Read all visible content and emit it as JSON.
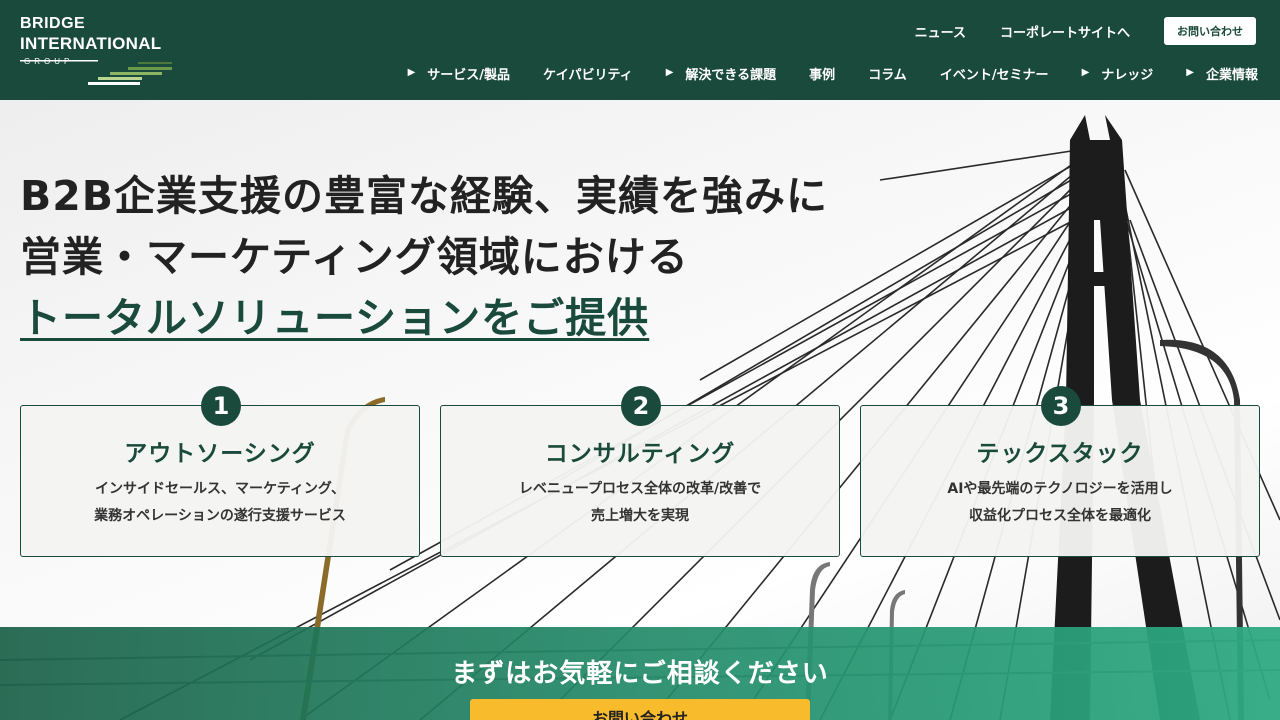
{
  "logo": {
    "line1": "BRIDGE",
    "line2": "INTERNATIONAL",
    "line3": "GROUP",
    "alt": "BRIDGE INTERNATIONAL GROUP"
  },
  "utility_nav": {
    "news": "ニュース",
    "corporate": "コーポレートサイトへ",
    "contact": "お問い合わせ"
  },
  "main_nav": [
    {
      "label": "サービス/製品",
      "has_arrow": true
    },
    {
      "label": "ケイパビリティ",
      "has_arrow": false
    },
    {
      "label": "解決できる課題",
      "has_arrow": true
    },
    {
      "label": "事例",
      "has_arrow": false
    },
    {
      "label": "コラム",
      "has_arrow": false
    },
    {
      "label": "イベント/セミナー",
      "has_arrow": false
    },
    {
      "label": "ナレッジ",
      "has_arrow": true
    },
    {
      "label": "企業情報",
      "has_arrow": true
    }
  ],
  "hero": {
    "line1": "B2B企業支援の豊富な経験、実績を強みに",
    "line2": "営業・マーケティング領域における",
    "line3": "トータルソリューションをご提供"
  },
  "cards": [
    {
      "number": "1",
      "title": "アウトソーシング",
      "desc1": "インサイドセールス、マーケティング、",
      "desc2": "業務オペレーションの遂行支援サービス"
    },
    {
      "number": "2",
      "title": "コンサルティング",
      "desc1": "レベニュープロセス全体の改革/改善で",
      "desc2": "売上増大を実現"
    },
    {
      "number": "3",
      "title": "テックスタック",
      "desc1": "AIや最先端のテクノロジーを活用し",
      "desc2": "収益化プロセス全体を最適化"
    }
  ],
  "cta": {
    "title": "まずはお気軽にご相談ください",
    "button": "お問い合わせ"
  },
  "colors": {
    "brand_green": "#1a4a3b",
    "cta_yellow": "#f7bb2c",
    "white": "#ffffff"
  }
}
